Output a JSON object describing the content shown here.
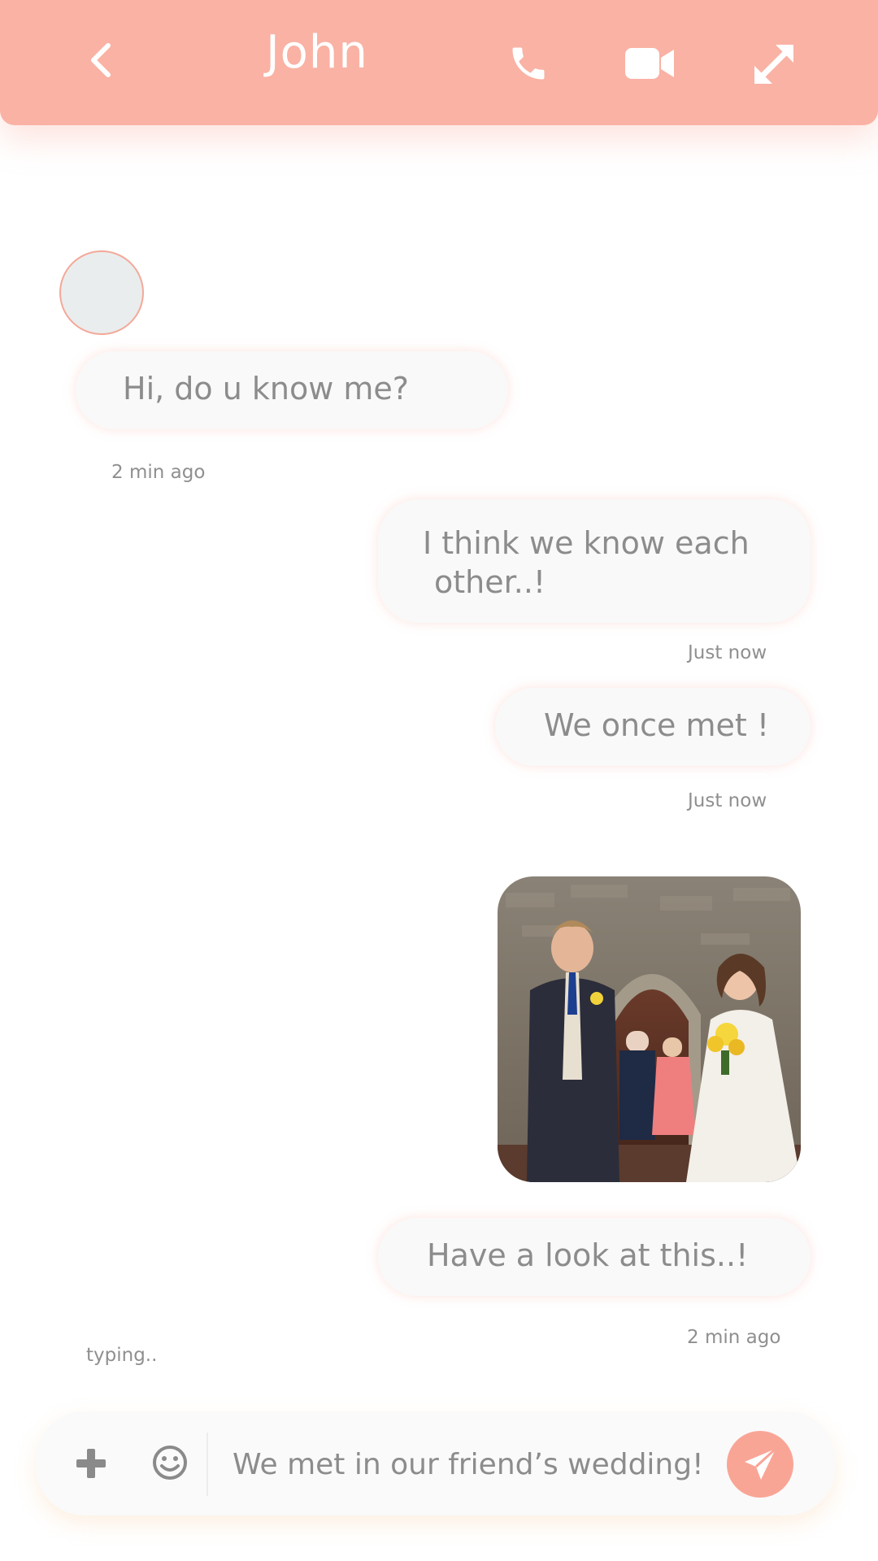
{
  "header": {
    "contact_name": "John",
    "icons": [
      "chevron-left-icon",
      "phone-icon",
      "video-camera-icon",
      "expand-icon"
    ],
    "color": "#f9b2a4"
  },
  "messages": [
    {
      "side": "incoming",
      "text": "Hi, do u know me?",
      "time": "2 min ago"
    },
    {
      "side": "outgoing",
      "text_line1": "I think we know each",
      "text_line2": "other..!",
      "time": "Just now"
    },
    {
      "side": "outgoing",
      "text": "We once met !",
      "time": "Just now"
    },
    {
      "side": "outgoing",
      "type": "image",
      "content": "photo"
    },
    {
      "side": "outgoing",
      "text": "Have a look at this..!",
      "time": "2 min ago"
    }
  ],
  "status": {
    "typing": "typing.."
  },
  "composer": {
    "value": "We met in our friend’s wedding!",
    "icons": [
      "plus-icon",
      "emoji-icon",
      "send-icon"
    ],
    "send_color": "#f9a596"
  }
}
